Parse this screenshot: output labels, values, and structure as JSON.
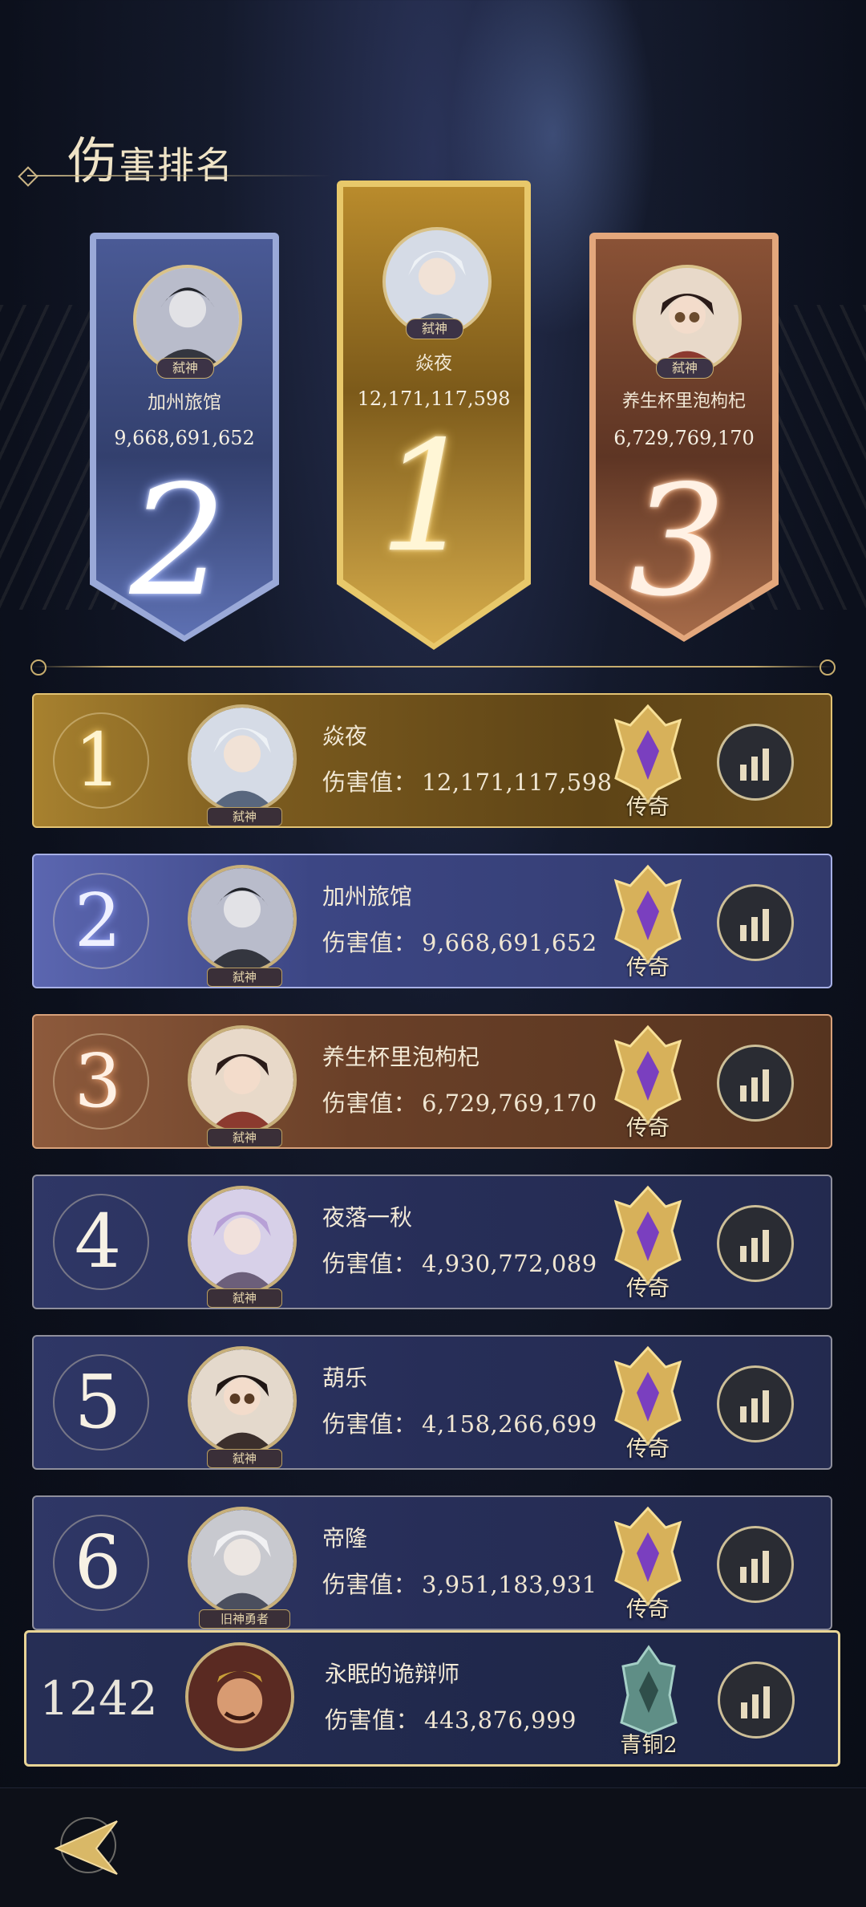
{
  "page": {
    "title_first": "伤",
    "title_rest": "害排名"
  },
  "podium": [
    {
      "rank": "2",
      "name": "加州旅馆",
      "score": "9,668,691,652",
      "badge": "弑神"
    },
    {
      "rank": "1",
      "name": "焱夜",
      "score": "12,171,117,598",
      "badge": "弑神"
    },
    {
      "rank": "3",
      "name": "养生杯里泡枸杞",
      "score": "6,729,769,170",
      "badge": "弑神"
    }
  ],
  "damage_label": "伤害值：",
  "rows": [
    {
      "rank": "1",
      "name": "焱夜",
      "damage": "12,171,117,598",
      "tag": "弑神",
      "tier": "传奇"
    },
    {
      "rank": "2",
      "name": "加州旅馆",
      "damage": "9,668,691,652",
      "tag": "弑神",
      "tier": "传奇"
    },
    {
      "rank": "3",
      "name": "养生杯里泡枸杞",
      "damage": "6,729,769,170",
      "tag": "弑神",
      "tier": "传奇"
    },
    {
      "rank": "4",
      "name": "夜落一秋",
      "damage": "4,930,772,089",
      "tag": "弑神",
      "tier": "传奇"
    },
    {
      "rank": "5",
      "name": "葫乐",
      "damage": "4,158,266,699",
      "tag": "弑神",
      "tier": "传奇"
    },
    {
      "rank": "6",
      "name": "帝隆",
      "damage": "3,951,183,931",
      "tag": "旧神勇者",
      "tier": "传奇"
    }
  ],
  "me": {
    "rank": "1242",
    "name": "永眠的诡辩师",
    "damage": "443,876,999",
    "tier": "青铜2"
  },
  "icons": {
    "stats": "bar-chart-icon",
    "tier_legend": "legend-tier-emblem-icon",
    "tier_bronze": "bronze-tier-emblem-icon",
    "back": "back-arrow-icon"
  },
  "colors": {
    "gold": "#e3c373",
    "silver": "#a7b0e6",
    "bronze": "#d8a17a",
    "list_bg": "#2f3766"
  }
}
